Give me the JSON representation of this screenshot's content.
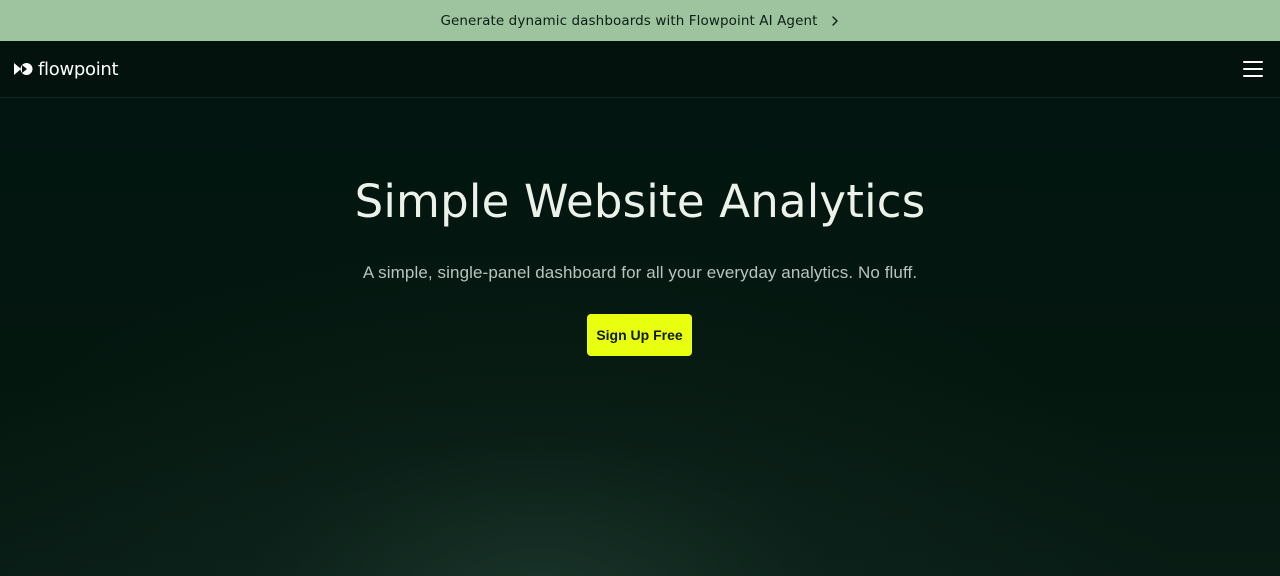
{
  "announcement": {
    "text": "Generate dynamic dashboards with Flowpoint AI Agent",
    "chevron_icon": "chevron-right-icon"
  },
  "navbar": {
    "logo_text": "flowpoint",
    "logo_icon": "flowpoint-logo-icon",
    "menu_icon": "hamburger-menu-icon"
  },
  "hero": {
    "title": "Simple Website Analytics",
    "subtitle": "A simple, single-panel dashboard for all your everyday analytics. No fluff.",
    "cta_label": "Sign Up Free"
  },
  "colors": {
    "announcement_bg": "#9dc39f",
    "page_bg": "#031510",
    "cta_bg": "#e9ff10",
    "title_text": "#ecf1ea"
  }
}
